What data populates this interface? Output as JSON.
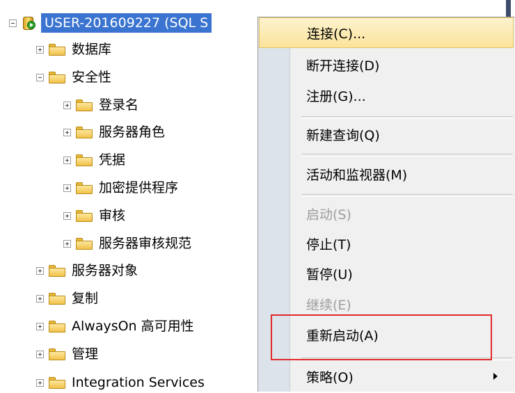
{
  "tree": {
    "server": "USER-201609227 (SQL S",
    "items": [
      {
        "label": "数据库"
      },
      {
        "label": "安全性"
      },
      {
        "label": "登录名"
      },
      {
        "label": "服务器角色"
      },
      {
        "label": "凭据"
      },
      {
        "label": "加密提供程序"
      },
      {
        "label": "审核"
      },
      {
        "label": "服务器审核规范"
      },
      {
        "label": "服务器对象"
      },
      {
        "label": "复制"
      },
      {
        "label": "AlwaysOn 高可用性"
      },
      {
        "label": "管理"
      },
      {
        "label": "Integration Services"
      }
    ]
  },
  "menu": {
    "items": [
      {
        "label": "连接(C)...",
        "state": "highlighted"
      },
      {
        "label": "断开连接(D)",
        "state": "enabled"
      },
      {
        "label": "注册(G)...",
        "state": "enabled"
      },
      {
        "label": "新建查询(Q)",
        "state": "enabled"
      },
      {
        "label": "活动和监视器(M)",
        "state": "enabled"
      },
      {
        "label": "启动(S)",
        "state": "disabled"
      },
      {
        "label": "停止(T)",
        "state": "enabled"
      },
      {
        "label": "暂停(U)",
        "state": "enabled"
      },
      {
        "label": "继续(E)",
        "state": "disabled"
      },
      {
        "label": "重新启动(A)",
        "state": "enabled"
      },
      {
        "label": "策略(O)",
        "state": "enabled",
        "has_submenu": true
      }
    ]
  },
  "colors": {
    "selection": "#3a74d0",
    "annotation_box": "#e02a2a",
    "menu_hover": "#fbe39a"
  }
}
